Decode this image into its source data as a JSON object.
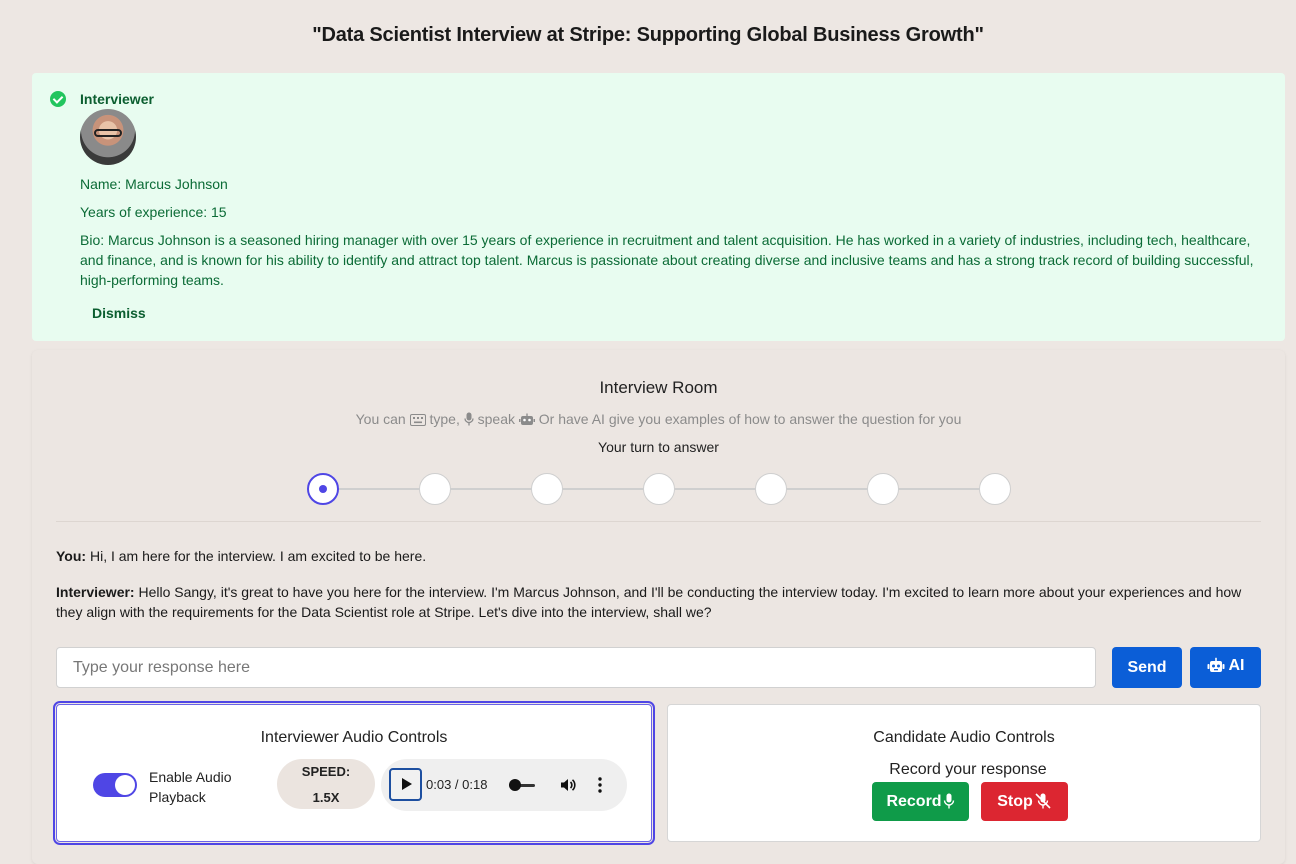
{
  "page": {
    "title": "\"Data Scientist Interview at Stripe: Supporting Global Business Growth\""
  },
  "interviewer_card": {
    "heading": "Interviewer",
    "name": "Name: Marcus Johnson",
    "experience": "Years of experience: 15",
    "bio": "Bio: Marcus Johnson is a seasoned hiring manager with over 15 years of experience in recruitment and talent acquisition. He has worked in a variety of industries, including tech, healthcare, and finance, and is known for his ability to identify and attract top talent. Marcus is passionate about creating diverse and inclusive teams and has a strong track record of building successful, high-performing teams.",
    "dismiss_label": "Dismiss",
    "accent_color": "#0b6b36",
    "background_color": "#e8fcf0"
  },
  "room": {
    "title": "Interview Room",
    "subtitle_parts": {
      "prefix": "You can",
      "type": "type,",
      "speak": "speak",
      "rest": "Or have AI give you examples of how to answer the question for you"
    },
    "turn_status": "Your turn to answer",
    "steps_total": 7,
    "current_step": 1,
    "messages": [
      {
        "speaker": "You:",
        "text": " Hi, I am here for the interview. I am excited to be here."
      },
      {
        "speaker": "Interviewer:",
        "text": " Hello Sangy, it's great to have you here for the interview. I'm Marcus Johnson, and I'll be conducting the interview today. I'm excited to learn more about your experiences and how they align with the requirements for the Data Scientist role at Stripe. Let's dive into the interview, shall we?"
      }
    ],
    "input": {
      "placeholder": "Type your response here",
      "value": ""
    },
    "send_label": "Send",
    "ai_label": "AI",
    "button_color": "#0b5ed7"
  },
  "interviewer_audio": {
    "title": "Interviewer Audio Controls",
    "toggle_label": "Enable Audio Playback",
    "toggle_on": true,
    "speed_label": "SPEED:",
    "speed_value": "1.5X",
    "time_display": "0:03 / 0:18",
    "progress_fraction": 0.17
  },
  "candidate_audio": {
    "title": "Candidate Audio Controls",
    "prompt": "Record your response",
    "record_label": "Record",
    "stop_label": "Stop",
    "record_color": "#0f9b49",
    "stop_color": "#dc2631"
  }
}
